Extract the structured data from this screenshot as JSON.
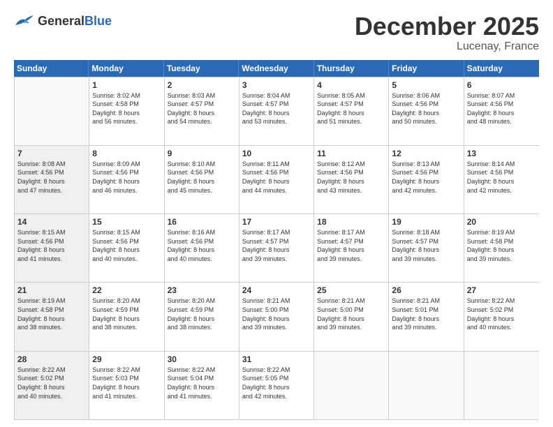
{
  "header": {
    "logo_general": "General",
    "logo_blue": "Blue",
    "month_title": "December 2025",
    "location": "Lucenay, France"
  },
  "weekdays": [
    "Sunday",
    "Monday",
    "Tuesday",
    "Wednesday",
    "Thursday",
    "Friday",
    "Saturday"
  ],
  "weeks": [
    [
      {
        "day": "",
        "sunrise": "",
        "sunset": "",
        "daylight": "",
        "empty": true
      },
      {
        "day": "1",
        "sunrise": "Sunrise: 8:02 AM",
        "sunset": "Sunset: 4:58 PM",
        "daylight": "Daylight: 8 hours and 56 minutes."
      },
      {
        "day": "2",
        "sunrise": "Sunrise: 8:03 AM",
        "sunset": "Sunset: 4:57 PM",
        "daylight": "Daylight: 8 hours and 54 minutes."
      },
      {
        "day": "3",
        "sunrise": "Sunrise: 8:04 AM",
        "sunset": "Sunset: 4:57 PM",
        "daylight": "Daylight: 8 hours and 53 minutes."
      },
      {
        "day": "4",
        "sunrise": "Sunrise: 8:05 AM",
        "sunset": "Sunset: 4:57 PM",
        "daylight": "Daylight: 8 hours and 51 minutes."
      },
      {
        "day": "5",
        "sunrise": "Sunrise: 8:06 AM",
        "sunset": "Sunset: 4:56 PM",
        "daylight": "Daylight: 8 hours and 50 minutes."
      },
      {
        "day": "6",
        "sunrise": "Sunrise: 8:07 AM",
        "sunset": "Sunset: 4:56 PM",
        "daylight": "Daylight: 8 hours and 48 minutes."
      }
    ],
    [
      {
        "day": "7",
        "sunrise": "Sunrise: 8:08 AM",
        "sunset": "Sunset: 4:56 PM",
        "daylight": "Daylight: 8 hours and 47 minutes."
      },
      {
        "day": "8",
        "sunrise": "Sunrise: 8:09 AM",
        "sunset": "Sunset: 4:56 PM",
        "daylight": "Daylight: 8 hours and 46 minutes."
      },
      {
        "day": "9",
        "sunrise": "Sunrise: 8:10 AM",
        "sunset": "Sunset: 4:56 PM",
        "daylight": "Daylight: 8 hours and 45 minutes."
      },
      {
        "day": "10",
        "sunrise": "Sunrise: 8:11 AM",
        "sunset": "Sunset: 4:56 PM",
        "daylight": "Daylight: 8 hours and 44 minutes."
      },
      {
        "day": "11",
        "sunrise": "Sunrise: 8:12 AM",
        "sunset": "Sunset: 4:56 PM",
        "daylight": "Daylight: 8 hours and 43 minutes."
      },
      {
        "day": "12",
        "sunrise": "Sunrise: 8:13 AM",
        "sunset": "Sunset: 4:56 PM",
        "daylight": "Daylight: 8 hours and 42 minutes."
      },
      {
        "day": "13",
        "sunrise": "Sunrise: 8:14 AM",
        "sunset": "Sunset: 4:56 PM",
        "daylight": "Daylight: 8 hours and 42 minutes."
      }
    ],
    [
      {
        "day": "14",
        "sunrise": "Sunrise: 8:15 AM",
        "sunset": "Sunset: 4:56 PM",
        "daylight": "Daylight: 8 hours and 41 minutes."
      },
      {
        "day": "15",
        "sunrise": "Sunrise: 8:15 AM",
        "sunset": "Sunset: 4:56 PM",
        "daylight": "Daylight: 8 hours and 40 minutes."
      },
      {
        "day": "16",
        "sunrise": "Sunrise: 8:16 AM",
        "sunset": "Sunset: 4:56 PM",
        "daylight": "Daylight: 8 hours and 40 minutes."
      },
      {
        "day": "17",
        "sunrise": "Sunrise: 8:17 AM",
        "sunset": "Sunset: 4:57 PM",
        "daylight": "Daylight: 8 hours and 39 minutes."
      },
      {
        "day": "18",
        "sunrise": "Sunrise: 8:17 AM",
        "sunset": "Sunset: 4:57 PM",
        "daylight": "Daylight: 8 hours and 39 minutes."
      },
      {
        "day": "19",
        "sunrise": "Sunrise: 8:18 AM",
        "sunset": "Sunset: 4:57 PM",
        "daylight": "Daylight: 8 hours and 39 minutes."
      },
      {
        "day": "20",
        "sunrise": "Sunrise: 8:19 AM",
        "sunset": "Sunset: 4:58 PM",
        "daylight": "Daylight: 8 hours and 39 minutes."
      }
    ],
    [
      {
        "day": "21",
        "sunrise": "Sunrise: 8:19 AM",
        "sunset": "Sunset: 4:58 PM",
        "daylight": "Daylight: 8 hours and 38 minutes."
      },
      {
        "day": "22",
        "sunrise": "Sunrise: 8:20 AM",
        "sunset": "Sunset: 4:59 PM",
        "daylight": "Daylight: 8 hours and 38 minutes."
      },
      {
        "day": "23",
        "sunrise": "Sunrise: 8:20 AM",
        "sunset": "Sunset: 4:59 PM",
        "daylight": "Daylight: 8 hours and 38 minutes."
      },
      {
        "day": "24",
        "sunrise": "Sunrise: 8:21 AM",
        "sunset": "Sunset: 5:00 PM",
        "daylight": "Daylight: 8 hours and 39 minutes."
      },
      {
        "day": "25",
        "sunrise": "Sunrise: 8:21 AM",
        "sunset": "Sunset: 5:00 PM",
        "daylight": "Daylight: 8 hours and 39 minutes."
      },
      {
        "day": "26",
        "sunrise": "Sunrise: 8:21 AM",
        "sunset": "Sunset: 5:01 PM",
        "daylight": "Daylight: 8 hours and 39 minutes."
      },
      {
        "day": "27",
        "sunrise": "Sunrise: 8:22 AM",
        "sunset": "Sunset: 5:02 PM",
        "daylight": "Daylight: 8 hours and 40 minutes."
      }
    ],
    [
      {
        "day": "28",
        "sunrise": "Sunrise: 8:22 AM",
        "sunset": "Sunset: 5:02 PM",
        "daylight": "Daylight: 8 hours and 40 minutes."
      },
      {
        "day": "29",
        "sunrise": "Sunrise: 8:22 AM",
        "sunset": "Sunset: 5:03 PM",
        "daylight": "Daylight: 8 hours and 41 minutes."
      },
      {
        "day": "30",
        "sunrise": "Sunrise: 8:22 AM",
        "sunset": "Sunset: 5:04 PM",
        "daylight": "Daylight: 8 hours and 41 minutes."
      },
      {
        "day": "31",
        "sunrise": "Sunrise: 8:22 AM",
        "sunset": "Sunset: 5:05 PM",
        "daylight": "Daylight: 8 hours and 42 minutes."
      },
      {
        "day": "",
        "sunrise": "",
        "sunset": "",
        "daylight": "",
        "empty": true
      },
      {
        "day": "",
        "sunrise": "",
        "sunset": "",
        "daylight": "",
        "empty": true
      },
      {
        "day": "",
        "sunrise": "",
        "sunset": "",
        "daylight": "",
        "empty": true
      }
    ]
  ]
}
